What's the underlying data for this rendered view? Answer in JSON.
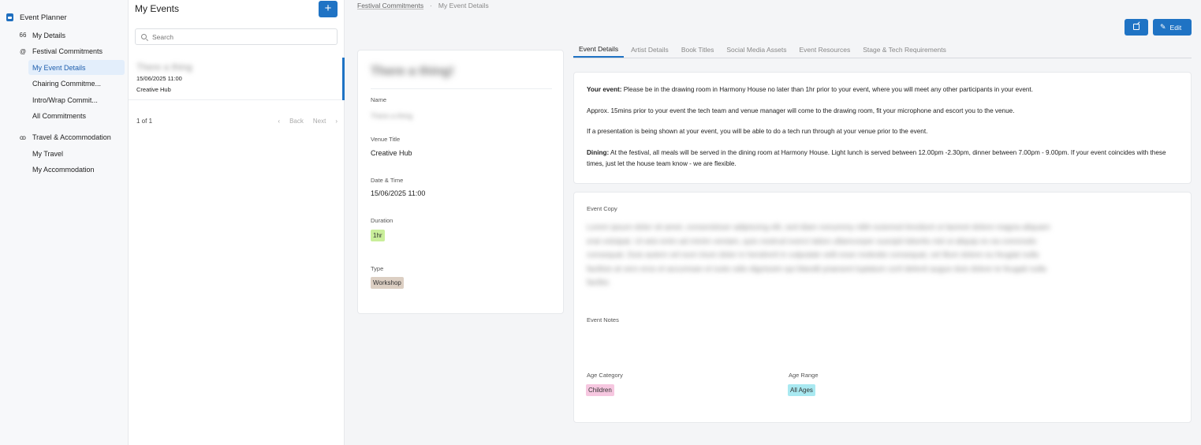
{
  "sidebar": {
    "app_title": "Event Planner",
    "items": [
      {
        "label": "My Details",
        "glyph": "66",
        "icon": "quote-icon"
      },
      {
        "label": "Festival Commitments",
        "glyph": "@",
        "icon": "at-icon"
      },
      {
        "label": "Travel & Accommodation",
        "glyph": "ꝏ",
        "icon": "bike-icon"
      }
    ],
    "festival_sub": [
      "My Event Details",
      "Chairing Commitme...",
      "Intro/Wrap Commit...",
      "All Commitments"
    ],
    "travel_sub": [
      "My Travel",
      "My Accommodation"
    ]
  },
  "list": {
    "title": "My Events",
    "add_label": "+",
    "search_placeholder": "Search",
    "rows": [
      {
        "name": "There a thing",
        "datetime": "15/06/2025 11:00",
        "venue": "Creative Hub"
      }
    ],
    "pager": {
      "count": "1 of 1",
      "back": "Back",
      "next": "Next"
    }
  },
  "breadcrumb": {
    "parent": "Festival Commitments",
    "sep": "·",
    "current": "My Event Details"
  },
  "toolbar": {
    "edit_label": "Edit"
  },
  "tabs": [
    "Event Details",
    "Artist Details",
    "Book Titles",
    "Social Media Assets",
    "Event Resources",
    "Stage & Tech Requirements"
  ],
  "event": {
    "title": "There a thing!",
    "fields": {
      "name_label": "Name",
      "name_value": "There a thing",
      "venue_label": "Venue Title",
      "venue_value": "Creative Hub",
      "date_label": "Date & Time",
      "date_value": "15/06/2025 11:00",
      "duration_label": "Duration",
      "duration_value": "1hr",
      "type_label": "Type",
      "type_value": "Workshop"
    }
  },
  "info": {
    "p1_bold": "Your event:",
    "p1": " Please be in the drawing room in Harmony House no later than 1hr prior to your event, where you will meet any other participants in your event.",
    "p2": "Approx. 15mins prior to your event the tech team and venue manager will come to the drawing room, fit your microphone and escort you to the venue.",
    "p3": "If a presentation is being shown at your event, you will be able to do a tech run through at your venue prior to the event.",
    "p4_bold": "Dining:",
    "p4": " At the festival, all meals will be served in the dining room at Harmony House. Light lunch is served between 12.00pm -2.30pm, dinner between 7.00pm - 9.00pm. If your event coincides with these times, just let the house team know - we are flexible."
  },
  "copy": {
    "copy_label": "Event Copy",
    "copy_text": "Lorem ipsum dolor sit amet, consectetuer adipiscing elit, sed diam nonummy nibh euismod tincidunt ut laoreet dolore magna aliquam erat volutpat. Ut wisi enim ad minim veniam, quis nostrud exerci tation ullamcorper suscipit lobortis nisl ut aliquip ex ea commodo consequat. Duis autem vel eum iriure dolor in hendrerit in vulputate velit esse molestie consequat, vel illum dolore eu feugiat nulla facilisis at vero eros et accumsan et iusto odio dignissim qui blandit praesent luptatum zzril delenit augue duis dolore te feugait nulla facilisi.",
    "notes_label": "Event Notes",
    "age_category_label": "Age Category",
    "age_category_value": "Children",
    "age_range_label": "Age Range",
    "age_range_value": "All Ages"
  }
}
